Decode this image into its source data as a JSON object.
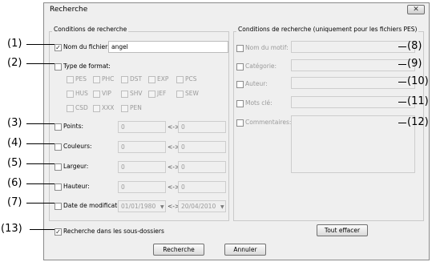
{
  "window": {
    "title": "Recherche",
    "close_glyph": "✕"
  },
  "left_group": {
    "title": "Conditions de recherche",
    "filename": {
      "label": "Nom du fichier:",
      "value": "angel",
      "checked": true
    },
    "format": {
      "label": "Type de format:",
      "rows": [
        [
          "PES",
          "PHC",
          "DST",
          "EXP",
          "PCS"
        ],
        [
          "HUS",
          "VIP",
          "SHV",
          "JEF",
          "SEW"
        ],
        [
          "CSD",
          "XXX",
          "PEN"
        ]
      ]
    },
    "ranges": [
      {
        "label": "Points:",
        "from": "0",
        "to": "0"
      },
      {
        "label": "Couleurs:",
        "from": "0",
        "to": "0"
      },
      {
        "label": "Largeur:",
        "from": "0",
        "to": "0"
      },
      {
        "label": "Hauteur:",
        "from": "0",
        "to": "0"
      }
    ],
    "date": {
      "label": "Date de modification:",
      "from": "01/01/1980",
      "to": "20/04/2010"
    },
    "range_sep": "<->"
  },
  "right_group": {
    "title": "Conditions de recherche (uniquement pour les fichiers PES)",
    "fields": [
      "Nom du motif:",
      "Catégorie:",
      "Auteur:",
      "Mots clé:",
      "Commentaires:"
    ]
  },
  "subfolders": {
    "label": "Recherche dans les sous-dossiers",
    "checked": true
  },
  "buttons": {
    "clear_all": "Tout effacer",
    "search": "Recherche",
    "cancel": "Annuler"
  },
  "callouts": [
    "(1)",
    "(2)",
    "(3)",
    "(4)",
    "(5)",
    "(6)",
    "(7)",
    "(8)",
    "(9)",
    "(10)",
    "(11)",
    "(12)",
    "(13)"
  ],
  "check_glyph": "✓"
}
